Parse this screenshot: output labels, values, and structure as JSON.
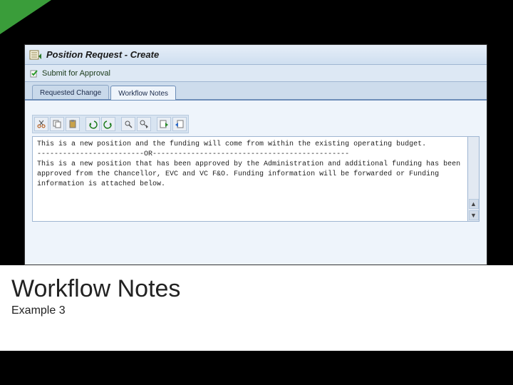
{
  "window": {
    "title": "Position Request - Create"
  },
  "actionbar": {
    "submit_label": "Submit for Approval"
  },
  "tabs": [
    {
      "label": "Requested Change",
      "active": false
    },
    {
      "label": "Workflow Notes",
      "active": true
    }
  ],
  "toolbar": {
    "buttons": [
      "cut-icon",
      "copy-icon",
      "paste-icon",
      "undo-icon",
      "redo-icon",
      "find-icon",
      "findnext-icon",
      "import-icon",
      "export-icon"
    ]
  },
  "notes": {
    "text": "This is a new position and the funding will come from within the existing operating budget.\n-------------------------OR----------------------------------------------\nThis is a new position that has been approved by the Administration and additional funding has been approved from the Chancellor, EVC and VC F&O. Funding information will be forwarded or Funding information is attached below."
  },
  "slide": {
    "heading": "Workflow Notes",
    "subheading": "Example 3"
  }
}
